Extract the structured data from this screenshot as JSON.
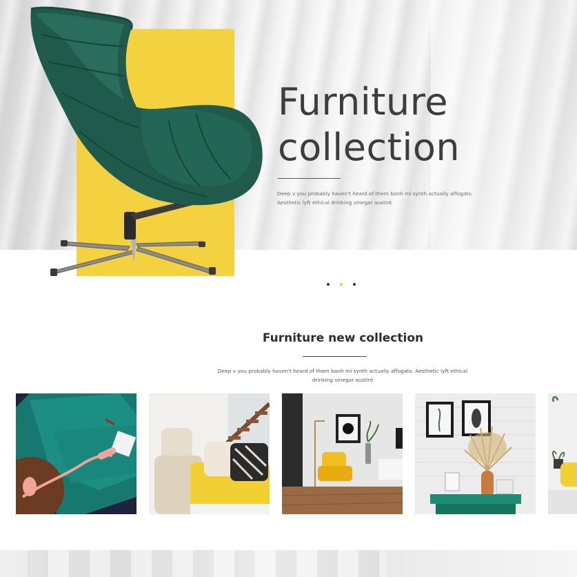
{
  "hero": {
    "title_line1": "Furniture",
    "title_line2": "collection",
    "text_line1": "Deep v you probably haven't heard of them banh mi synth actually affogato.",
    "text_line2": "Aesthetic lyft ethical drinking vinegar austint"
  },
  "slider": {
    "total": 3,
    "active_index": 1
  },
  "section": {
    "title": "Furniture new collection",
    "text_line1": "Deep v you probably haven't heard of them banh mi synth actually affogato. Aesthetic lyft ethical",
    "text_line2": "drinking vinegar austint"
  },
  "colors": {
    "accent": "#f4d23f",
    "heading": "#3d3d3d"
  },
  "gallery": [
    {
      "icon": "green-velvet-sofa-phone-photo"
    },
    {
      "icon": "cream-armchair-yellow-sofa-photo"
    },
    {
      "icon": "yellow-armchair-floor-lamp-photo"
    },
    {
      "icon": "dried-flowers-vase-green-console-photo"
    },
    {
      "icon": "yellow-chair-plant-photo"
    }
  ]
}
